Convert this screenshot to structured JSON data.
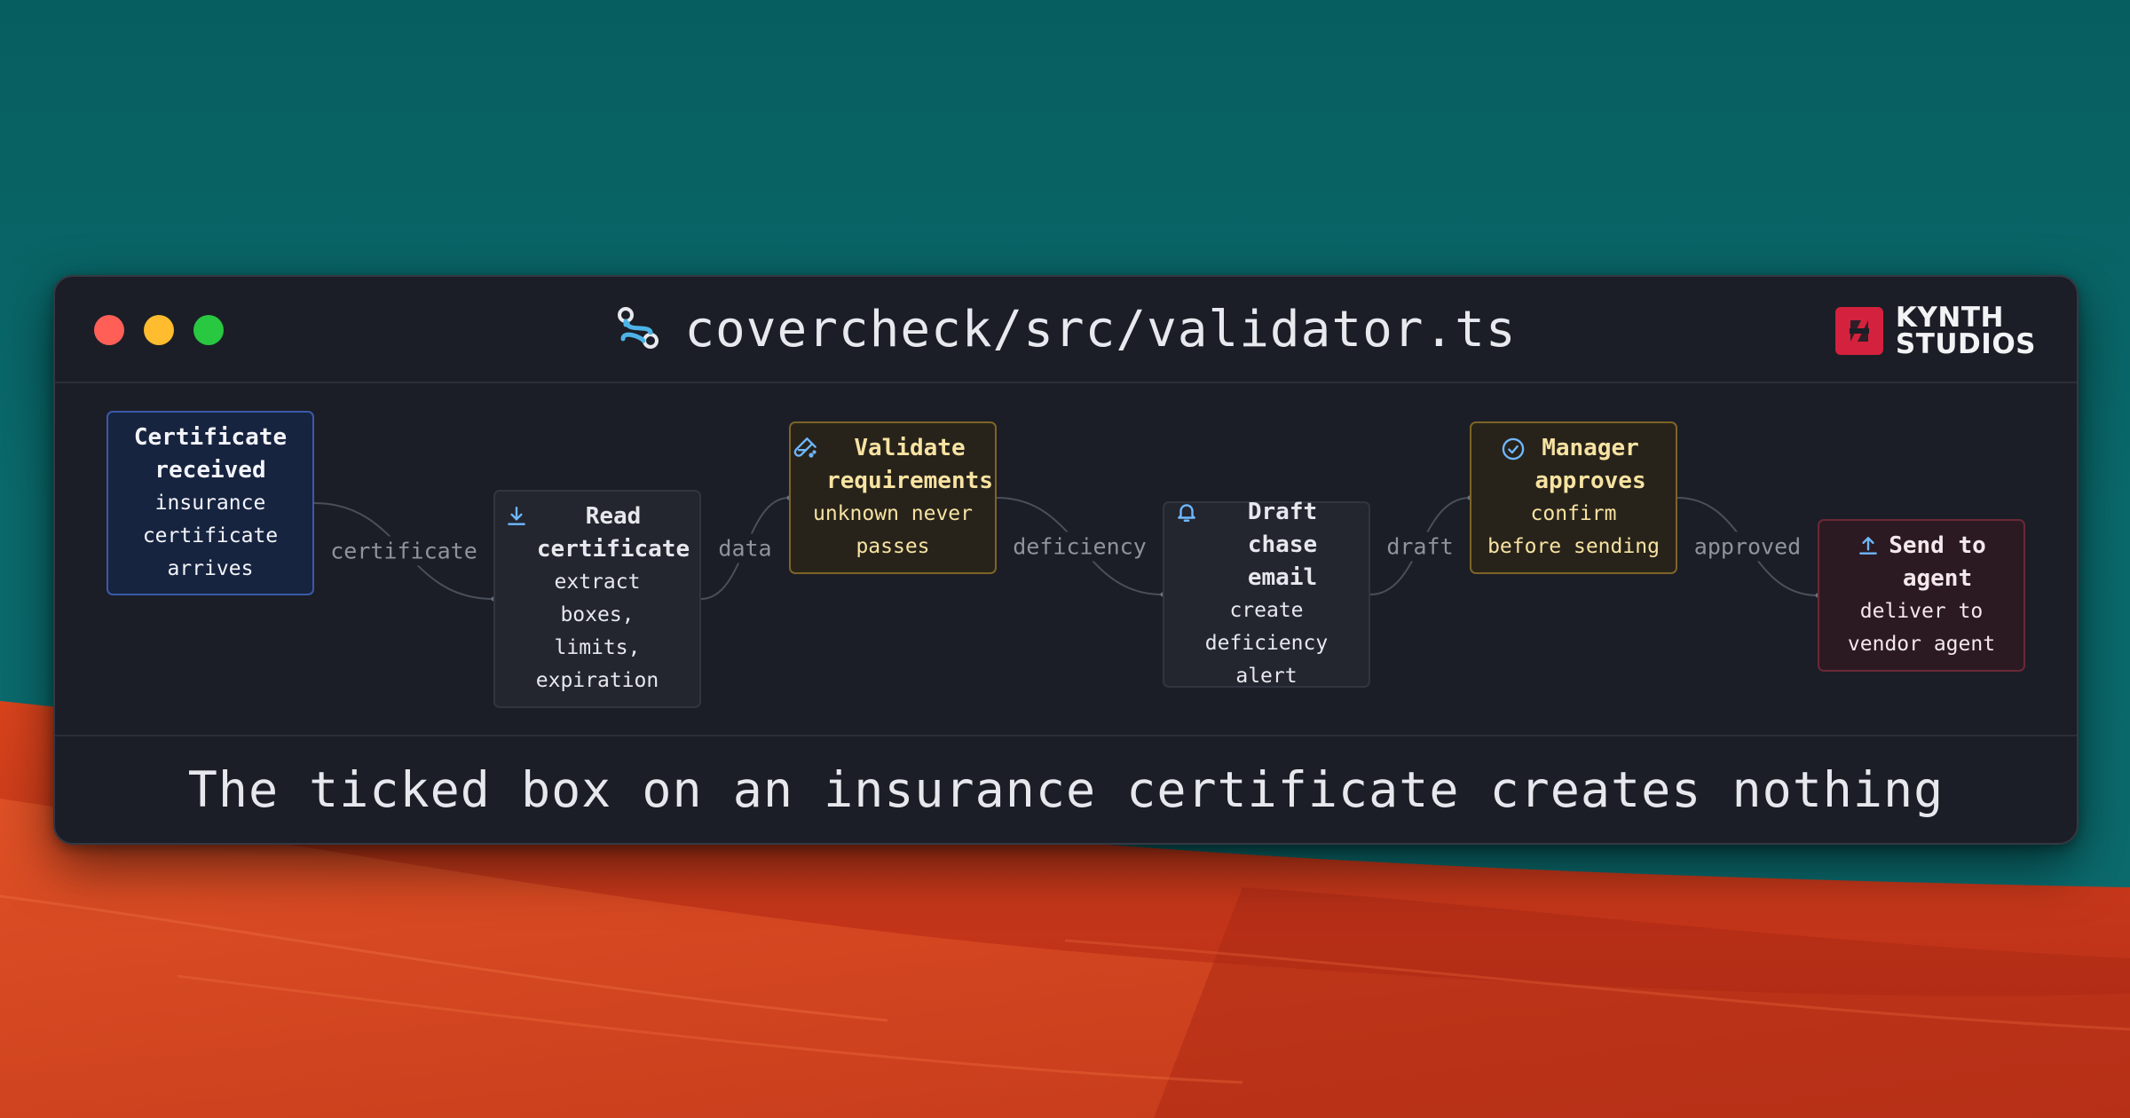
{
  "window": {
    "title": "covercheck/src/validator.ts",
    "title_icon": "route-icon",
    "brand": {
      "line1": "KYNTH",
      "line2": "STUDIOS",
      "logo_color": "#d4213d"
    }
  },
  "diagram": {
    "nodes": [
      {
        "id": "received",
        "title": "Certificate\nreceived",
        "desc": "insurance\ncertificate\narrives",
        "icon": "",
        "style": "blue"
      },
      {
        "id": "read",
        "title": "Read\ncertificate",
        "desc": "extract\nboxes,\nlimits,\nexpiration",
        "icon": "download-icon",
        "style": "gray"
      },
      {
        "id": "validate",
        "title": "Validate\nrequirements",
        "desc": "unknown never\npasses",
        "icon": "test-tube-icon",
        "style": "amber"
      },
      {
        "id": "draft",
        "title": "Draft\nchase email",
        "desc": "create\ndeficiency\nalert",
        "icon": "bell-icon",
        "style": "gray"
      },
      {
        "id": "approve",
        "title": "Manager\napproves",
        "desc": "confirm\nbefore sending",
        "icon": "check-circle-icon",
        "style": "amber"
      },
      {
        "id": "send",
        "title": "Send to\nagent",
        "desc": "deliver to\nvendor agent",
        "icon": "upload-icon",
        "style": "maroon"
      }
    ],
    "edges": [
      {
        "from": "received",
        "to": "read",
        "label": "certificate"
      },
      {
        "from": "read",
        "to": "validate",
        "label": "data"
      },
      {
        "from": "validate",
        "to": "draft",
        "label": "deficiency"
      },
      {
        "from": "draft",
        "to": "approve",
        "label": "draft"
      },
      {
        "from": "approve",
        "to": "send",
        "label": "approved"
      }
    ]
  },
  "caption": "The ticked box on an insurance certificate creates nothing"
}
